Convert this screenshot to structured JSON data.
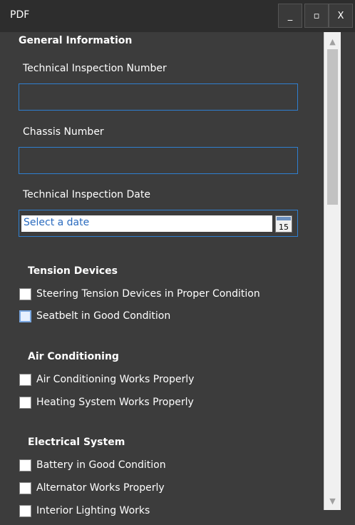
{
  "window": {
    "title": "PDF",
    "minimize": "_",
    "maximize": "▫",
    "close": "X"
  },
  "general": {
    "title": "General Information",
    "inspection_number_label": "Technical Inspection Number",
    "chassis_label": "Chassis Number",
    "inspection_date_label": "Technical Inspection Date",
    "date_placeholder": "Select a date",
    "calendar_day": "15"
  },
  "tension": {
    "title": "Tension Devices",
    "items": [
      {
        "label": "Steering Tension Devices in Proper Condition"
      },
      {
        "label": "Seatbelt in Good Condition"
      }
    ]
  },
  "air": {
    "title": "Air Conditioning",
    "items": [
      {
        "label": "Air Conditioning Works Properly"
      },
      {
        "label": "Heating System Works Properly"
      }
    ]
  },
  "electrical": {
    "title": "Electrical System",
    "items": [
      {
        "label": "Battery in Good Condition"
      },
      {
        "label": "Alternator Works Properly"
      },
      {
        "label": "Interior Lighting Works"
      }
    ]
  },
  "scrollbar": {
    "up": "▲",
    "down": "▼"
  }
}
